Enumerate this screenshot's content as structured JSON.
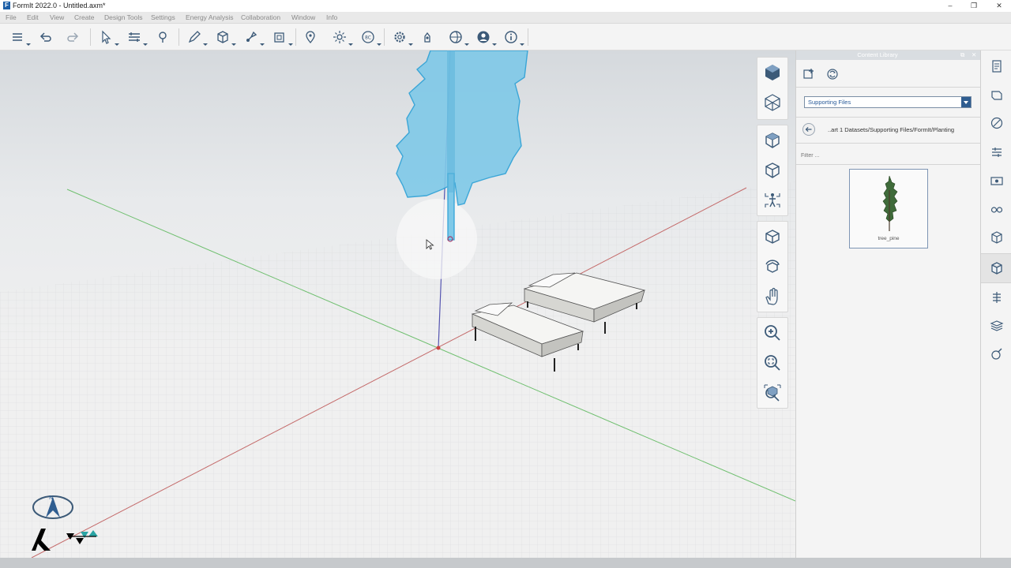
{
  "window": {
    "title": "FormIt 2022.0 - Untitled.axm*",
    "controls": [
      "–",
      "❐",
      "✕"
    ]
  },
  "menu": [
    "File",
    "Edit",
    "View",
    "Create",
    "Design Tools",
    "Settings",
    "Energy Analysis",
    "Collaboration",
    "Window",
    "Info"
  ],
  "toolbar": {
    "buttons": [
      "layers-icon",
      "undo-icon",
      "redo-icon",
      "select-icon",
      "align-icon",
      "paint-icon",
      "draw-icon",
      "primitive-icon",
      "tools-icon",
      "group-icon",
      "location-icon",
      "sun-icon",
      "scenes-icon",
      "settings-icon",
      "dynamo-icon",
      "share-icon",
      "account-icon",
      "info-icon"
    ]
  },
  "content_library": {
    "title": "Content Library",
    "library_selected": "Supporting Files",
    "path": "..art 1 Datasets/Supporting Files/FormIt/Planting",
    "filter_placeholder": "Filter ...",
    "items": [
      {
        "label": "tree_pine"
      }
    ]
  },
  "colors": {
    "accent": "#2f5d90",
    "axis_x": "#c85a5a",
    "axis_y": "#55b055",
    "axis_z": "#5a5ab0",
    "selection": "#6fc6ea"
  }
}
